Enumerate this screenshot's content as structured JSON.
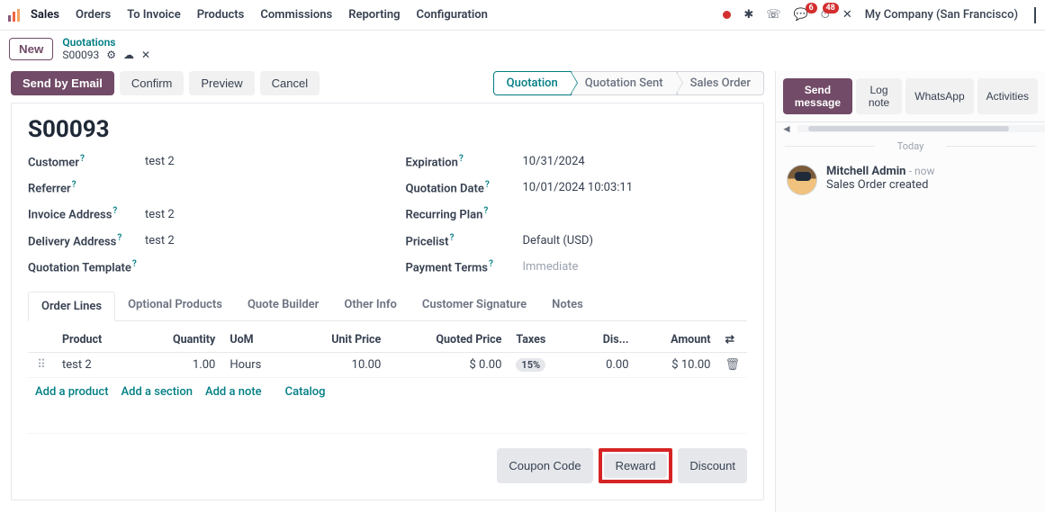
{
  "nav": {
    "items": [
      "Sales",
      "Orders",
      "To Invoice",
      "Products",
      "Commissions",
      "Reporting",
      "Configuration"
    ],
    "company": "My Company (San Francisco)",
    "chat_badge": "6",
    "clock_badge": "48"
  },
  "crumb": {
    "new": "New",
    "top": "Quotations",
    "id": "S00093"
  },
  "form": {
    "buttons": {
      "send": "Send by Email",
      "confirm": "Confirm",
      "preview": "Preview",
      "cancel": "Cancel"
    },
    "status": [
      "Quotation",
      "Quotation Sent",
      "Sales Order"
    ],
    "status_active": 0,
    "title": "S00093",
    "left": {
      "customer_lbl": "Customer",
      "customer": "test 2",
      "referrer_lbl": "Referrer",
      "referrer": "",
      "inv_lbl": "Invoice Address",
      "inv": "test 2",
      "del_lbl": "Delivery Address",
      "del": "test 2",
      "tpl_lbl": "Quotation Template",
      "tpl": ""
    },
    "right": {
      "exp_lbl": "Expiration",
      "exp": "10/31/2024",
      "qdate_lbl": "Quotation Date",
      "qdate": "10/01/2024 10:03:11",
      "rplan_lbl": "Recurring Plan",
      "rplan": "",
      "plist_lbl": "Pricelist",
      "plist": "Default (USD)",
      "pterm_lbl": "Payment Terms",
      "pterm": "Immediate"
    }
  },
  "tabs": [
    "Order Lines",
    "Optional Products",
    "Quote Builder",
    "Other Info",
    "Customer Signature",
    "Notes"
  ],
  "lines": {
    "headers": {
      "product": "Product",
      "qty": "Quantity",
      "uom": "UoM",
      "uprice": "Unit Price",
      "qprice": "Quoted Price",
      "taxes": "Taxes",
      "disc": "Dis...",
      "amount": "Amount"
    },
    "rows": [
      {
        "product": "test 2",
        "qty": "1.00",
        "uom": "Hours",
        "uprice": "10.00",
        "qprice": "$ 0.00",
        "tax": "15%",
        "disc": "0.00",
        "amount": "$ 10.00"
      }
    ],
    "add": {
      "product": "Add a product",
      "section": "Add a section",
      "note": "Add a note",
      "catalog": "Catalog"
    },
    "footer": {
      "coupon": "Coupon Code",
      "reward": "Reward",
      "discount": "Discount"
    }
  },
  "chat": {
    "bar": {
      "send": "Send message",
      "log": "Log note",
      "wa": "WhatsApp",
      "act": "Activities"
    },
    "day": "Today",
    "msgs": [
      {
        "who": "Mitchell Admin",
        "when": "now",
        "txt": "Sales Order created"
      }
    ]
  }
}
